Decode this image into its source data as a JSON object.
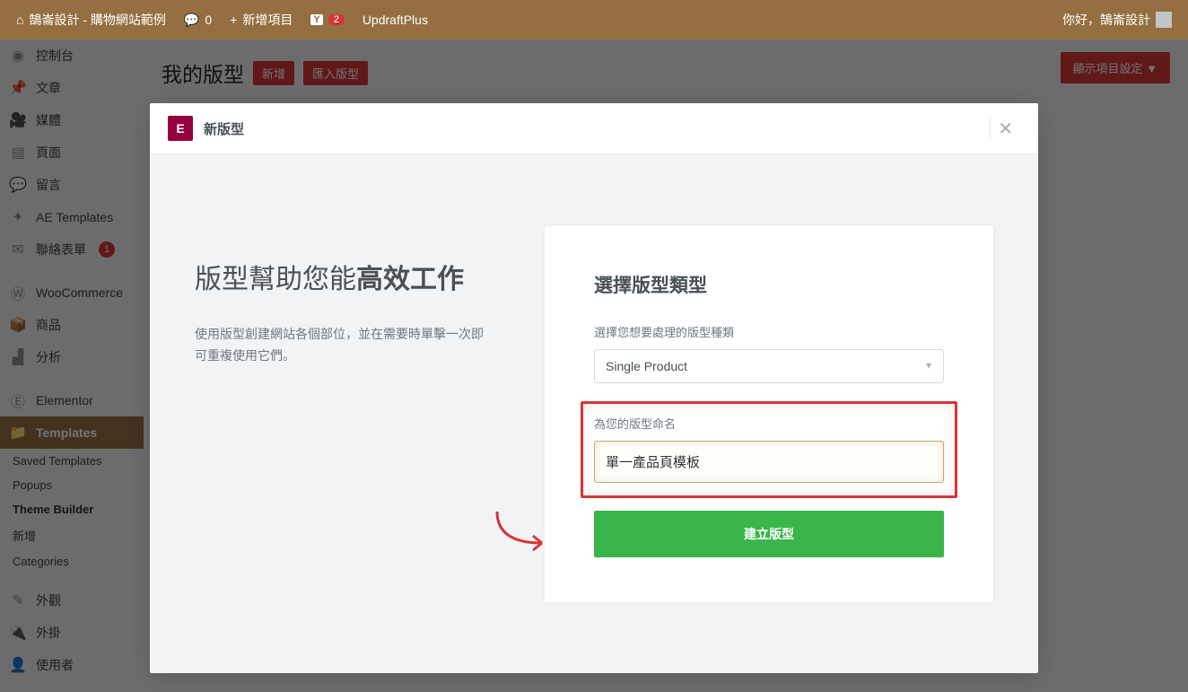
{
  "toolbar": {
    "site_name": "鵠崙設計 - 購物網站範例",
    "comments": "0",
    "new_label": "新增項目",
    "yoast_count": "2",
    "updraft": "UpdraftPlus",
    "greeting": "你好，鵠崙設計"
  },
  "sidebar": {
    "dashboard": "控制台",
    "posts": "文章",
    "media": "媒體",
    "pages": "頁面",
    "comments": "留言",
    "ae": "AE Templates",
    "contact": "聯絡表單",
    "contact_count": "1",
    "woo": "WooCommerce",
    "products": "商品",
    "analytics": "分析",
    "elementor": "Elementor",
    "templates": "Templates",
    "appearance": "外觀",
    "plugins": "外掛",
    "users": "使用者"
  },
  "submenu": {
    "saved": "Saved Templates",
    "popups": "Popups",
    "theme_builder": "Theme Builder",
    "add_new": "新增",
    "categories": "Categories"
  },
  "page": {
    "title": "我的版型",
    "add_new": "新增",
    "import": "匯入版型",
    "screen_options": "顯示項目設定 ▼"
  },
  "modal": {
    "header": "新版型",
    "left_h_pre": "版型幫助您能",
    "left_h_strong": "高效工作",
    "left_p": "使用版型創建網站各個部位，並在需要時單擊一次即可重複使用它們。",
    "right_h": "選擇版型類型",
    "type_label": "選擇您想要處理的版型種類",
    "type_value": "Single Product",
    "name_label": "為您的版型命名",
    "name_value": "單一產品頁模板",
    "create": "建立版型"
  }
}
